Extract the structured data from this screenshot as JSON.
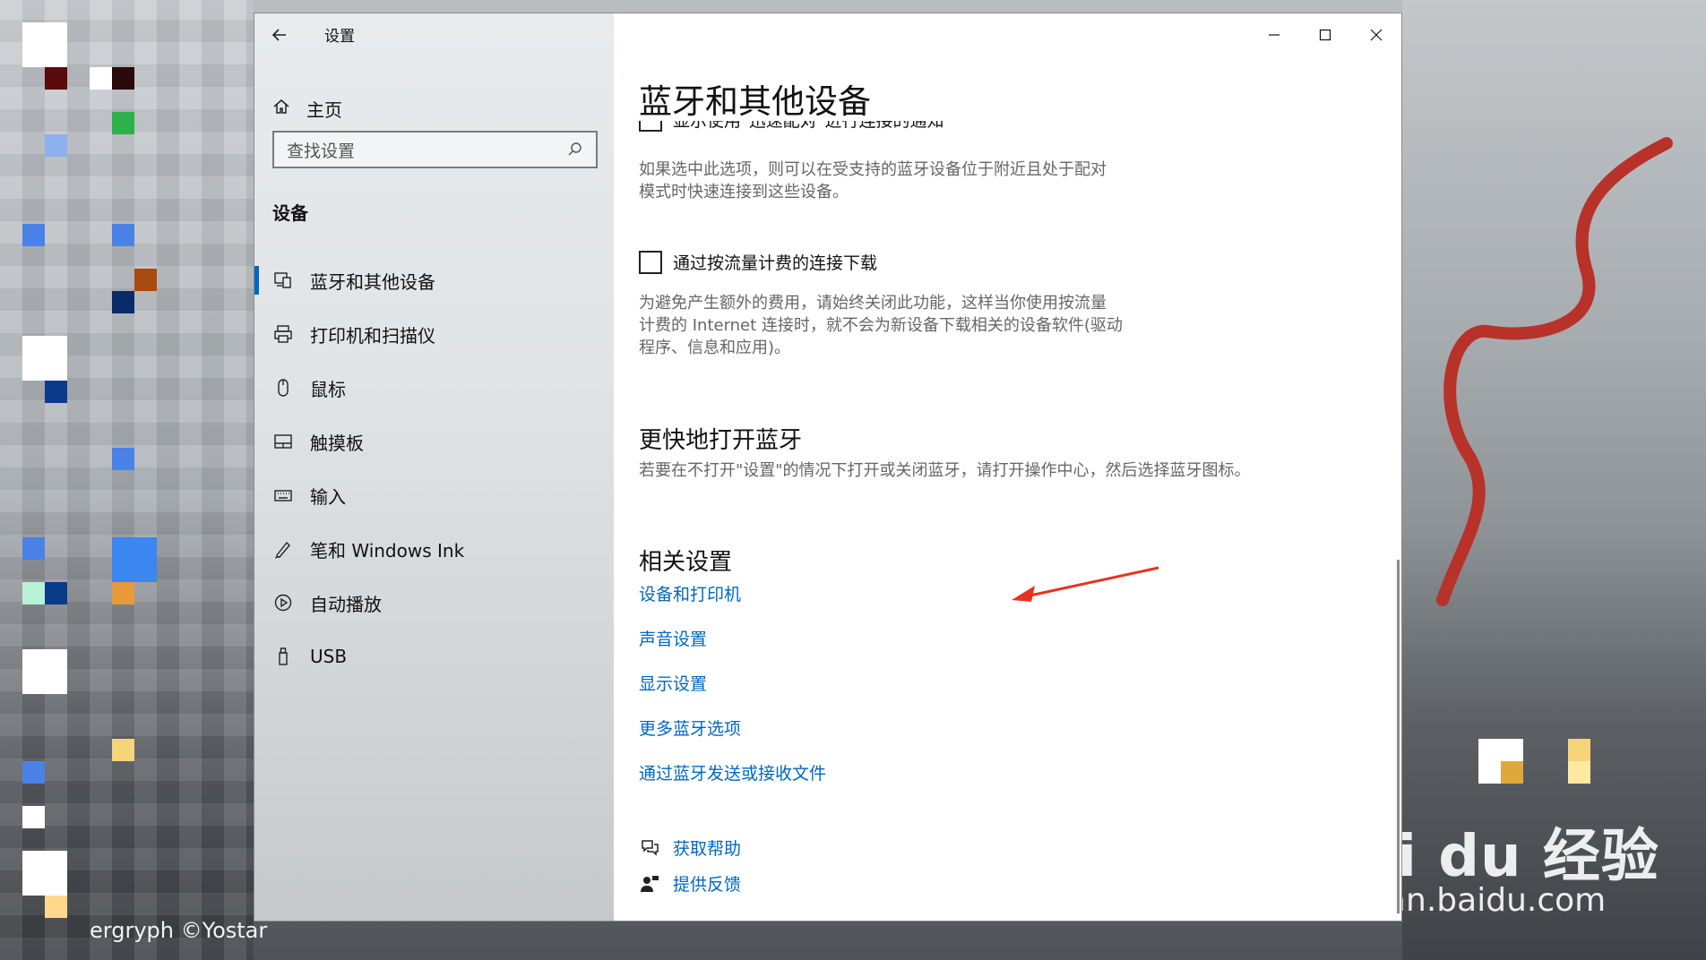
{
  "window": {
    "title": "设置",
    "back_icon": "back-arrow-icon",
    "controls": [
      "minimize-icon",
      "maximize-icon",
      "close-icon"
    ]
  },
  "sidebar": {
    "home_label": "主页",
    "search_placeholder": "查找设置",
    "section_label": "设备",
    "items": [
      {
        "label": "蓝牙和其他设备",
        "icon": "bluetooth-devices-icon",
        "active": true
      },
      {
        "label": "打印机和扫描仪",
        "icon": "printer-icon",
        "active": false
      },
      {
        "label": "鼠标",
        "icon": "mouse-icon",
        "active": false
      },
      {
        "label": "触摸板",
        "icon": "touchpad-icon",
        "active": false
      },
      {
        "label": "输入",
        "icon": "keyboard-icon",
        "active": false
      },
      {
        "label": "笔和 Windows Ink",
        "icon": "pen-icon",
        "active": false
      },
      {
        "label": "自动播放",
        "icon": "autoplay-icon",
        "active": false
      },
      {
        "label": "USB",
        "icon": "usb-icon",
        "active": false
      }
    ]
  },
  "main": {
    "page_title": "蓝牙和其他设备",
    "clipped_option": "显示使用\"迅速配对\"进行连接的通知",
    "swift_pair_desc_line1": "如果选中此选项，则可以在受支持的蓝牙设备位于附近且处于配对",
    "swift_pair_desc_line2": "模式时快速连接到这些设备。",
    "metered_label": "通过按流量计费的连接下载",
    "metered_desc_line1": "为避免产生额外的费用，请始终关闭此功能，这样当你使用按流量",
    "metered_desc_line2": "计费的 Internet 连接时，就不会为新设备下载相关的设备软件(驱动",
    "metered_desc_line3": "程序、信息和应用)。",
    "bluetooth_heading": "更快地打开蓝牙",
    "bluetooth_desc": "若要在不打开\"设置\"的情况下打开或关闭蓝牙，请打开操作中心，然后选择蓝牙图标。",
    "related_heading": "相关设置",
    "related_links": [
      "设备和打印机",
      "声音设置",
      "显示设置",
      "更多蓝牙选项",
      "通过蓝牙发送或接收文件"
    ],
    "help_label": "获取帮助",
    "feedback_label": "提供反馈"
  },
  "desktop": {
    "credit": "ergryph  ©Yostar",
    "watermark": "Bai du 经验",
    "watermark_url": "jingyan.baidu.com",
    "annotation_color": "#e8321e",
    "accent_color": "#0067c0"
  }
}
